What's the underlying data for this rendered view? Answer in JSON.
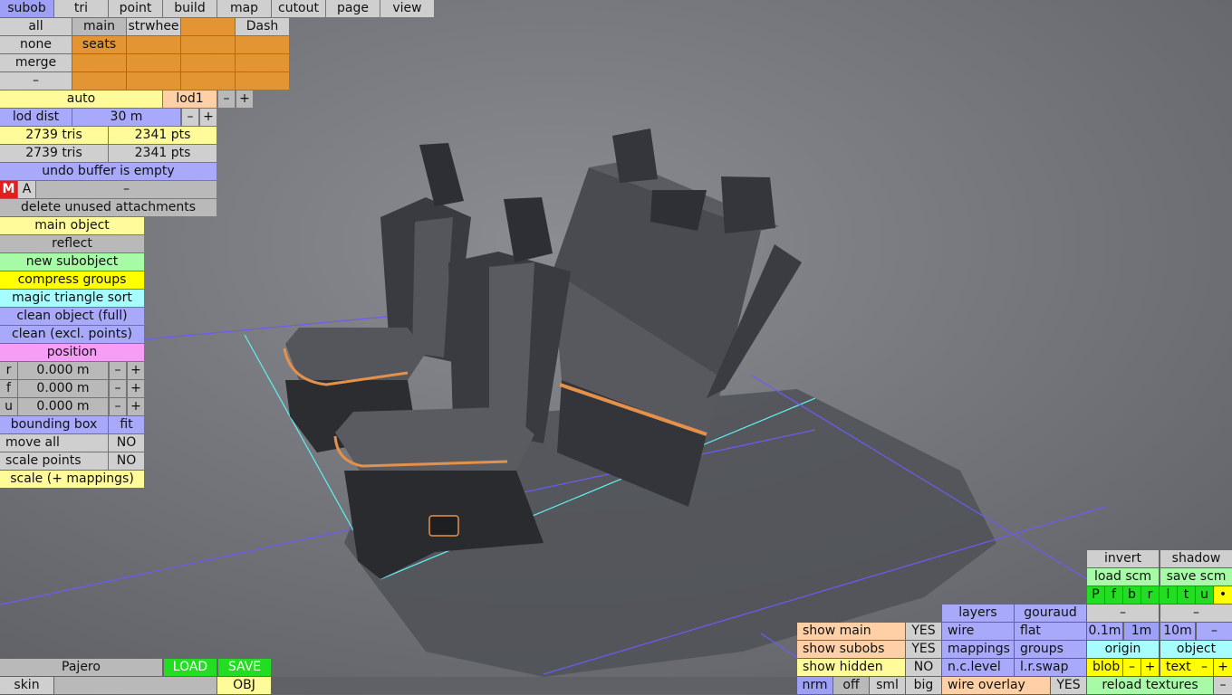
{
  "colors": {
    "viewport": "#6b6d72",
    "accent_orange": "#e39433",
    "accent_yellow": "#fffb9a",
    "accent_blue": "#a9a9fb",
    "accent_green": "#a7fba7"
  },
  "menu": {
    "tabs": [
      "subob",
      "tri",
      "point",
      "build",
      "map",
      "cutout",
      "page",
      "view"
    ],
    "active": "subob"
  },
  "subob": {
    "all": "all",
    "main": "main",
    "strwhee": "strwhee",
    "dash": "Dash",
    "none": "none",
    "seats": "seats",
    "merge": "merge",
    "dash2": "–"
  },
  "lod": {
    "auto": "auto",
    "lod1": "lod1",
    "minus": "–",
    "plus": "+",
    "dist_label": "lod dist",
    "dist_value": "30 m"
  },
  "stats": {
    "tris1": "2739 tris",
    "pts1": "2341 pts",
    "tris2": "2739 tris",
    "pts2": "2341 pts"
  },
  "undo": "undo buffer is empty",
  "ma": {
    "m": "M",
    "a": "A",
    "dash": "–"
  },
  "left": {
    "delete_unused": "delete unused attachments",
    "main_object": "main object",
    "reflect": "reflect",
    "new_subobject": "new subobject",
    "compress_groups": "compress groups",
    "magic_sort": "magic triangle sort",
    "clean_full": "clean object (full)",
    "clean_excl": "clean (excl. points)",
    "position": "position",
    "r_label": "r",
    "r_value": "0.000 m",
    "f_label": "f",
    "f_value": "0.000 m",
    "u_label": "u",
    "u_value": "0.000 m",
    "bounding_box": "bounding box",
    "fit": "fit",
    "move_all": "move all",
    "move_all_val": "NO",
    "scale_points": "scale points",
    "scale_points_val": "NO",
    "scale_mappings": "scale (+ mappings)"
  },
  "bottom_left": {
    "file_name": "Pajero",
    "load": "LOAD",
    "save": "SAVE",
    "skin": "skin",
    "obj": "OBJ"
  },
  "bottom_right": {
    "invert": "invert",
    "shadow": "shadow",
    "load_scm": "load scm",
    "save_scm": "save scm",
    "flags": [
      "P",
      "f",
      "b",
      "r",
      "l",
      "t",
      "u",
      "•"
    ],
    "dash": "–",
    "layers": "layers",
    "gouraud": "gouraud",
    "wire": "wire",
    "flat": "flat",
    "mappings": "mappings",
    "groups": "groups",
    "nclevel": "n.c.level",
    "lrswap": "l.r.swap",
    "show_main": "show main",
    "show_main_val": "YES",
    "show_subobs": "show subobs",
    "show_subobs_val": "YES",
    "show_hidden": "show hidden",
    "show_hidden_val": "NO",
    "nrm": "nrm",
    "off": "off",
    "sml": "sml",
    "big": "big",
    "wire_overlay": "wire overlay",
    "wire_overlay_val": "YES",
    "grid": [
      "0.1m",
      "1m",
      "10m"
    ],
    "origin": "origin",
    "object": "object",
    "blob": "blob",
    "text": "text",
    "reload_textures": "reload textures"
  }
}
